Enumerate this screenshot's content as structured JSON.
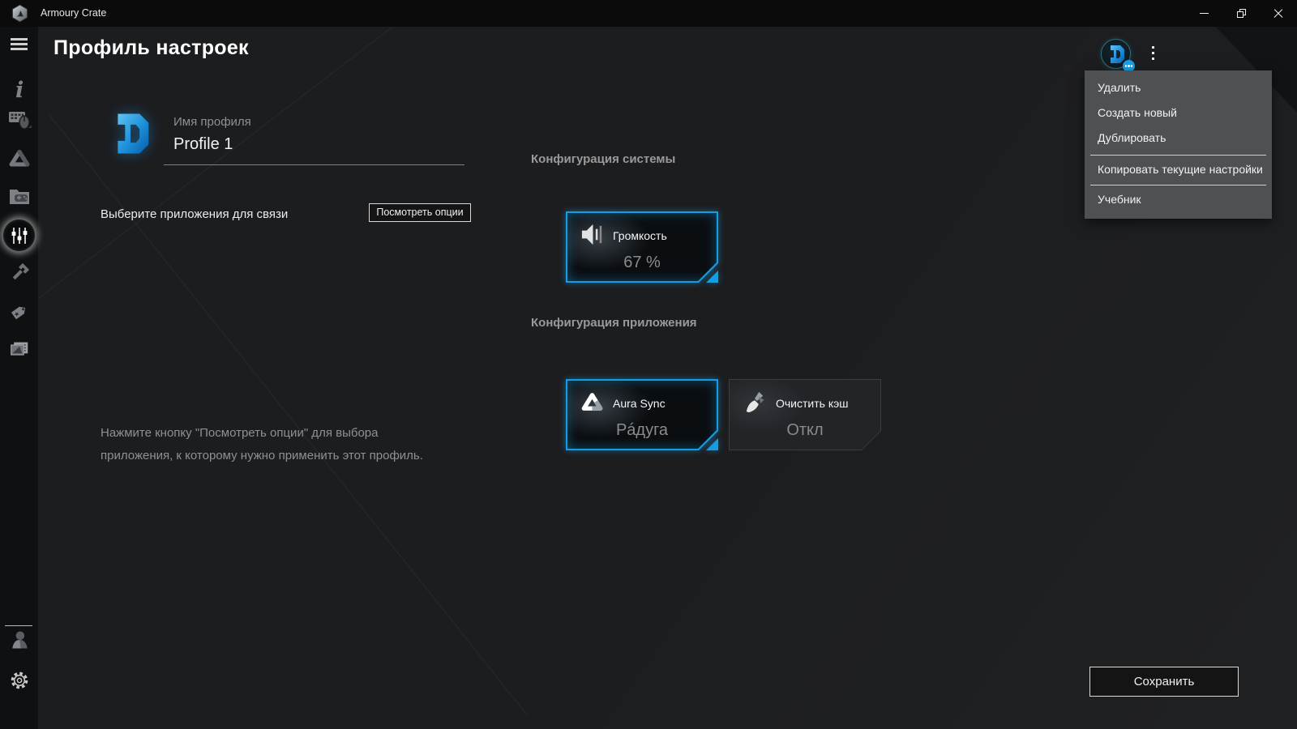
{
  "window": {
    "title": "Armoury Crate"
  },
  "titlebar_controls": [
    "minimize",
    "restore",
    "close"
  ],
  "colors": {
    "accent_blue": "#149de4",
    "titlebar_bg": "#0b0b0c",
    "sidebar_bg": "#0f1011",
    "content_bg": "#1c1d1f",
    "menu_bg": "#4f5052",
    "card_dark_bg": "#0b0e11",
    "gray_card_bg": "#222528",
    "muted_text": "#8f8f8f"
  },
  "sidebar": {
    "items": [
      {
        "icon": "menu-hamburger-icon"
      },
      {
        "icon": "info-icon"
      },
      {
        "icon": "devices-icon"
      },
      {
        "icon": "aura-icon"
      },
      {
        "icon": "game-library-icon"
      },
      {
        "icon": "profiles-sliders-icon",
        "active": true
      },
      {
        "icon": "tools-icon"
      },
      {
        "icon": "tag-icon"
      },
      {
        "icon": "news-icon"
      },
      {
        "icon": "user-icon"
      },
      {
        "icon": "settings-gear-icon"
      }
    ]
  },
  "page": {
    "title": "Профиль настроек",
    "profile": {
      "name_label": "Имя профиля",
      "name_value": "Profile 1"
    },
    "link_apps": {
      "label": "Выберите приложения для связи",
      "button": "Посмотреть опции"
    },
    "system_config": {
      "heading": "Конфигурация системы",
      "cards": [
        {
          "icon": "volume-icon",
          "label": "Громкость",
          "value": "67 %"
        }
      ]
    },
    "app_config": {
      "heading": "Конфигурация приложения",
      "cards": [
        {
          "icon": "aura-icon",
          "label": "Aura Sync",
          "value": "Рáдуга"
        },
        {
          "icon": "clean-cache-icon",
          "label": "Очистить кэш",
          "value": "Откл"
        }
      ]
    },
    "hint_lines": [
      "Нажмите кнопку \"Посмотреть опции\" для выбора",
      "приложения, к которому нужно применить этот профиль."
    ],
    "save_label": "Сохранить"
  },
  "profile_menu": {
    "items": [
      "Удалить",
      "Создать новый",
      "Дублировать",
      "Копировать текущие настройки",
      "Учебник"
    ]
  }
}
